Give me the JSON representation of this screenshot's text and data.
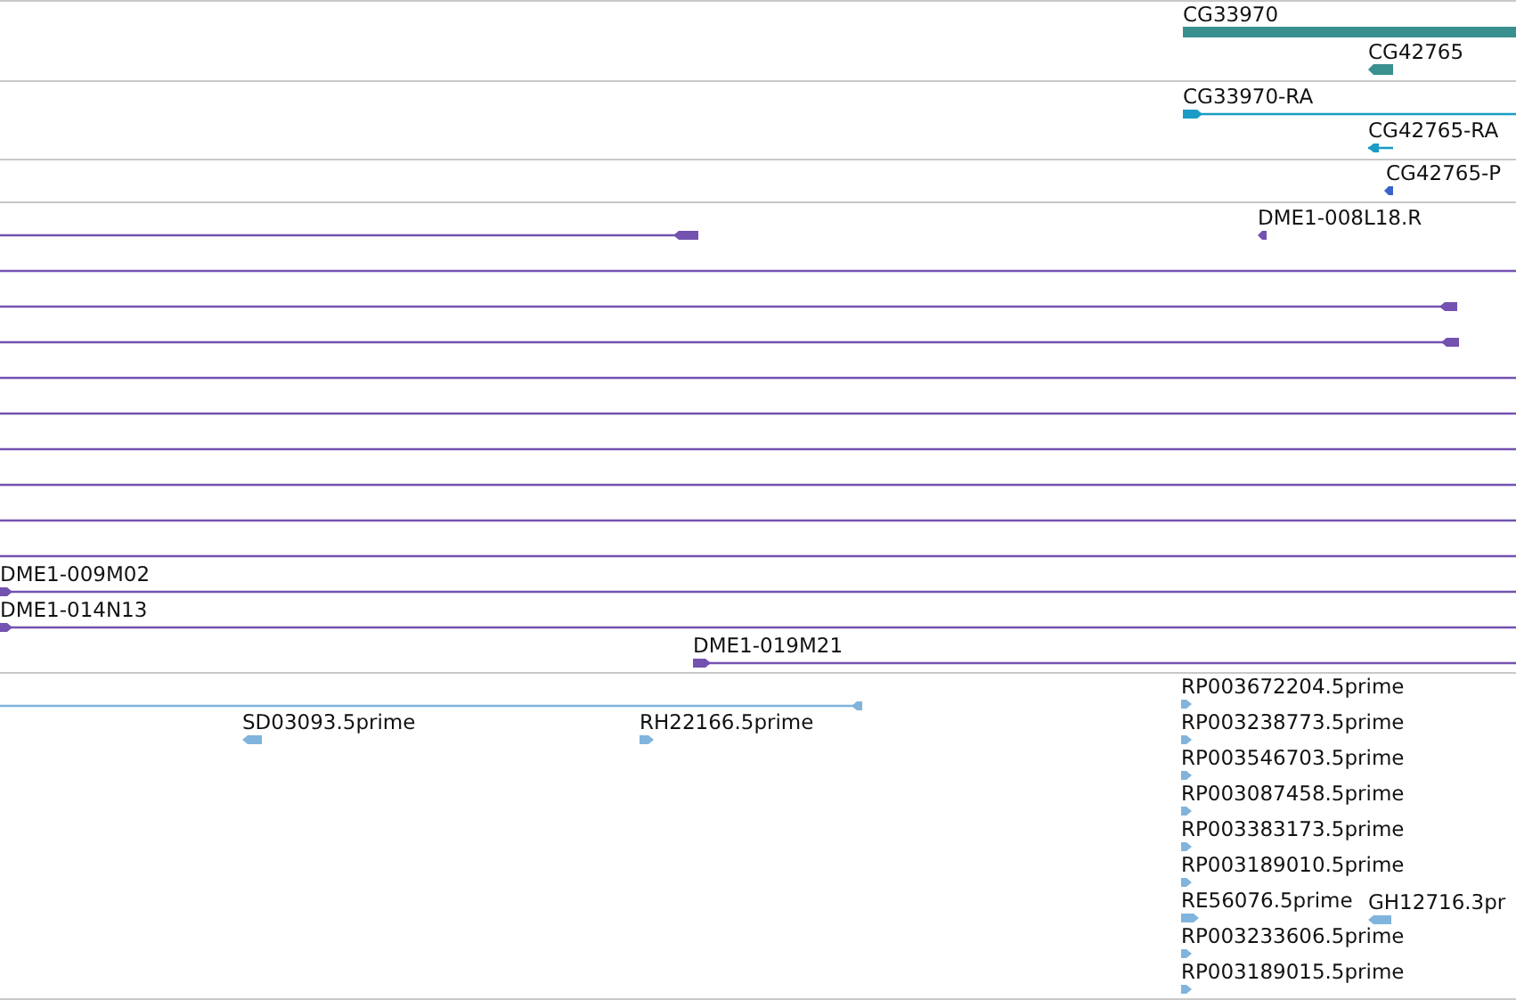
{
  "tracks": [
    {
      "kind": "gene",
      "color": "#3a8f8f",
      "features": [
        {
          "label": "CG33970",
          "kind": "bar"
        },
        {
          "label": "CG42765",
          "kind": "marker",
          "reverse": true
        }
      ]
    },
    {
      "kind": "transcript",
      "color": "#1a9cc4",
      "features": [
        {
          "label": "CG33970-RA",
          "kind": "arrow_line",
          "reverse": false
        },
        {
          "label": "CG42765-RA",
          "kind": "arrow_line",
          "reverse": true
        }
      ]
    },
    {
      "kind": "protein",
      "color": "#3a62c9",
      "features": [
        {
          "label": "CG42765-P",
          "kind": "marker",
          "reverse": true
        }
      ]
    },
    {
      "kind": "clone",
      "color": "#7352b0",
      "features": [
        {
          "label": "DME1-008L18.R",
          "kind": "marker",
          "reverse": true
        },
        {
          "kind": "arrow_line",
          "reverse": true
        },
        {
          "kind": "line"
        },
        {
          "kind": "arrow_line",
          "reverse": true
        },
        {
          "kind": "arrow_line",
          "reverse": true
        },
        {
          "kind": "line"
        },
        {
          "kind": "line"
        },
        {
          "kind": "line"
        },
        {
          "kind": "line"
        },
        {
          "kind": "line"
        },
        {
          "kind": "line"
        },
        {
          "label": "DME1-009M02",
          "kind": "arrow_line",
          "reverse": false
        },
        {
          "label": "DME1-014N13",
          "kind": "arrow_line",
          "reverse": false
        },
        {
          "label": "DME1-019M21",
          "kind": "arrow_line",
          "reverse": false
        }
      ]
    },
    {
      "kind": "est",
      "color": "#80b4dc",
      "features": [
        {
          "kind": "arrow_line",
          "reverse": true
        },
        {
          "label": "SD03093.5prime",
          "kind": "marker",
          "reverse": true
        },
        {
          "label": "RH22166.5prime",
          "kind": "marker",
          "reverse": false
        },
        {
          "label": "RP003672204.5prime",
          "kind": "marker",
          "reverse": false
        },
        {
          "label": "RP003238773.5prime",
          "kind": "marker",
          "reverse": false
        },
        {
          "label": "RP003546703.5prime",
          "kind": "marker",
          "reverse": false
        },
        {
          "label": "RP003087458.5prime",
          "kind": "marker",
          "reverse": false
        },
        {
          "label": "RP003383173.5prime",
          "kind": "marker",
          "reverse": false
        },
        {
          "label": "RP003189010.5prime",
          "kind": "marker",
          "reverse": false
        },
        {
          "label": "RE56076.5prime",
          "kind": "marker",
          "reverse": false
        },
        {
          "label": "GH12716.3pr",
          "kind": "marker",
          "reverse": true
        },
        {
          "label": "RP003233606.5prime",
          "kind": "marker",
          "reverse": false
        },
        {
          "label": "RP003189015.5prime",
          "kind": "marker",
          "reverse": false
        }
      ]
    }
  ]
}
